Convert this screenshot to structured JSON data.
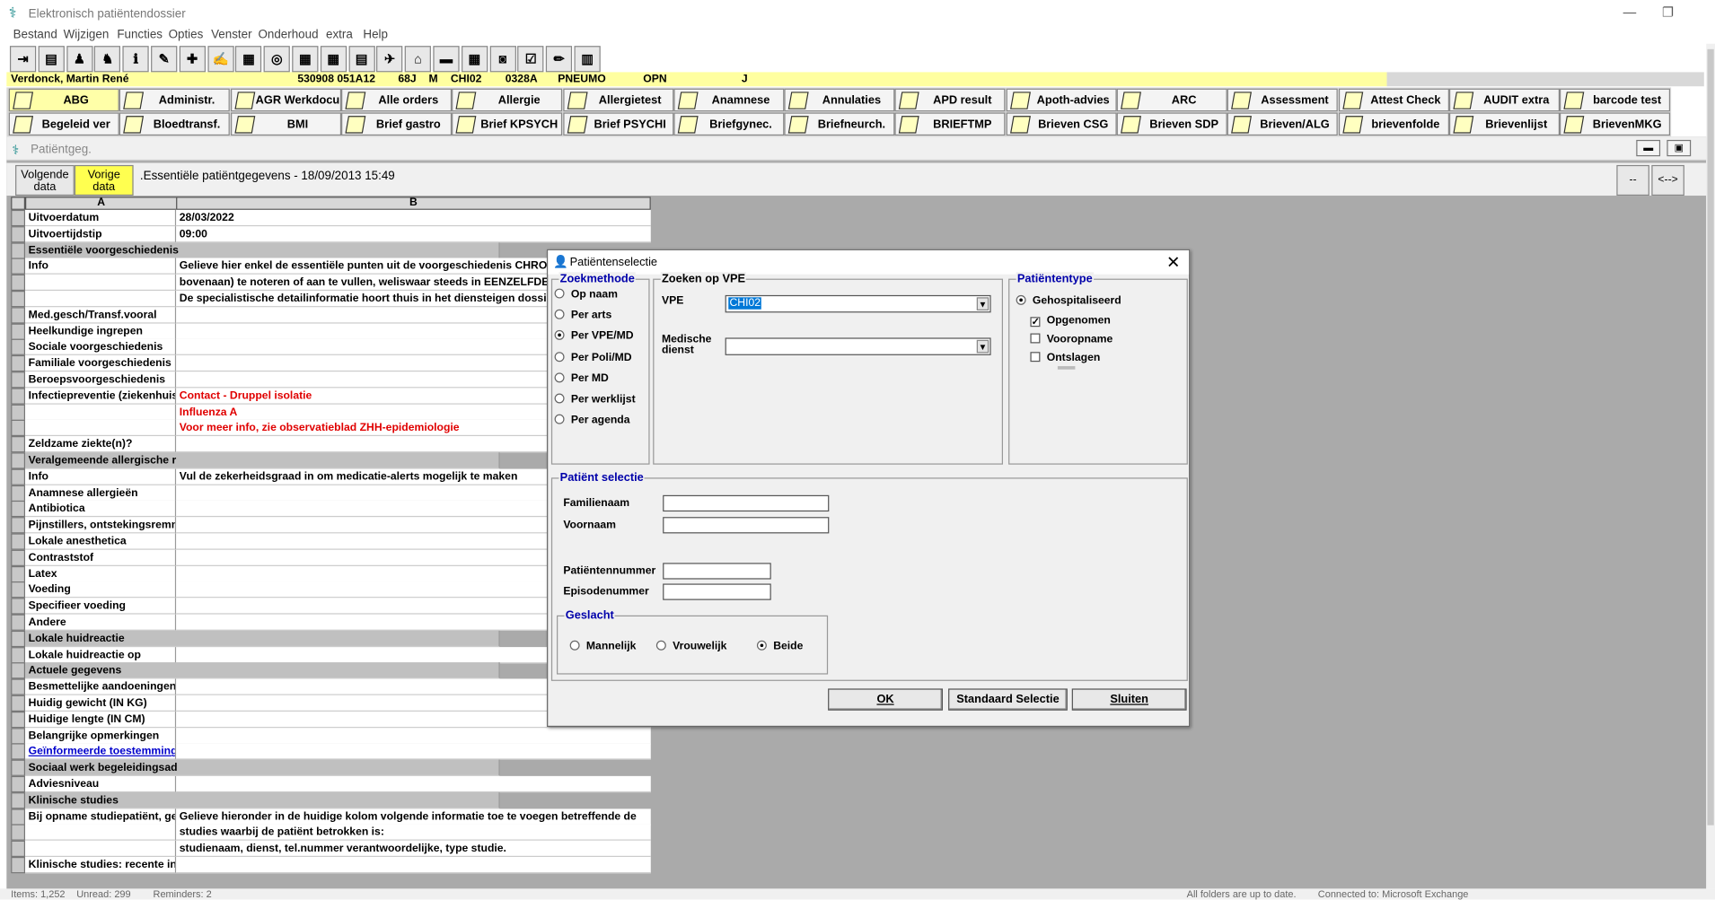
{
  "window": {
    "title": "Elektronisch patiëntendossier",
    "menu": [
      "Bestand",
      "Wijzigen",
      "Functies",
      "Opties",
      "Venster",
      "Onderhoud",
      "extra",
      "Help"
    ]
  },
  "toolbar": {
    "icons": [
      "user-door-icon",
      "printer-icon",
      "person-icon",
      "people-icon",
      "person-info-icon",
      "syringe-icon",
      "pills-icon",
      "edit-doc-icon",
      "calendar-icon",
      "glasses-doc-icon",
      "grid-icon",
      "calendar-grid-icon",
      "report-icon",
      "bird-icon",
      "house-icon",
      "eraser-icon",
      "table-icon",
      "camera-icon",
      "checklist-icon",
      "pen-icon",
      "chart-icon"
    ]
  },
  "patient": {
    "name": "Verdonck,  Martin René",
    "id": "530908 051A12",
    "age": "68J",
    "sex": "M",
    "unit": "CHI02",
    "room": "0328A",
    "dept": "PNEUMO",
    "status": "OPN",
    "flag": "J"
  },
  "folders": {
    "row1": [
      "ABG",
      "Administr.",
      "AGR Werkdocu",
      "Alle orders",
      "Allergie",
      "Allergietest",
      "Anamnese",
      "Annulaties",
      "APD result",
      "Apoth-advies",
      "ARC",
      "Assessment",
      "Attest Check",
      "AUDIT extra",
      "barcode test"
    ],
    "row2": [
      "Begeleid ver",
      "Bloedtransf.",
      "BMI",
      "Brief gastro",
      "Brief KPSYCH",
      "Brief PSYCHI",
      "Briefgynec.",
      "Briefneurch.",
      "BRIEFTMP",
      "Brieven CSG",
      "Brieven SDP",
      "Brieven/ALG",
      "brievenfolde",
      "Brievenlijst",
      "BrievenMKG"
    ]
  },
  "subwindow": {
    "title": "Patiëntgeg.",
    "next_label_1": "Volgende",
    "next_label_2": "data",
    "prev_label_1": "Vorige",
    "prev_label_2": "data",
    "record_title": ".Essentiële patiëntgegevens - 18/09/2013 15:49",
    "right_btn_1": "--",
    "right_btn_2": "<-->",
    "col_a": "A",
    "col_b": "B"
  },
  "rows": [
    {
      "a": "Uitvoerdatum",
      "b": "28/03/2022"
    },
    {
      "a": "Uitvoertijdstip",
      "b": "09:00"
    },
    {
      "a": "Essentiële voorgeschiedenis",
      "section": true
    },
    {
      "a": "Info",
      "b": "Gelieve hier enkel de essentiële punten uit de voorgeschiedenis CHRON"
    },
    {
      "a": "",
      "b": "bovenaan) te noteren of aan te vullen, weliswaar steeds in EENZELFDE"
    },
    {
      "a": "",
      "b": "De specialistische detailinformatie hoort thuis in het diensteigen dossier."
    },
    {
      "a": "Med.gesch/Transf.vooral",
      "b": ""
    },
    {
      "a": "Heelkundige ingrepen",
      "b": ""
    },
    {
      "a": "Sociale voorgeschiedenis",
      "b": ""
    },
    {
      "a": "Familiale voorgeschiedenis",
      "b": ""
    },
    {
      "a": "Beroepsvoorgeschiedenis",
      "b": ""
    },
    {
      "a": "Infectiepreventie (ziekenhuis",
      "b": "Contact - Druppel isolatie",
      "red": true
    },
    {
      "a": "",
      "b": "Influenza A",
      "red": true
    },
    {
      "a": "",
      "b": "Voor meer info, zie observatieblad ZHH-epidemiologie",
      "red": true
    },
    {
      "a": "Zeldzame ziekte(n)?",
      "b": ""
    },
    {
      "a": "Veralgemeende allergische r",
      "section": true
    },
    {
      "a": "Info",
      "b": "Vul de zekerheidsgraad in om medicatie-alerts mogelijk te maken"
    },
    {
      "a": "Anamnese allergieën",
      "b": ""
    },
    {
      "a": "Antibiotica",
      "b": ""
    },
    {
      "a": "Pijnstillers, ontstekingsremme",
      "b": ""
    },
    {
      "a": "Lokale anesthetica",
      "b": ""
    },
    {
      "a": "Contraststof",
      "b": ""
    },
    {
      "a": "Latex",
      "b": ""
    },
    {
      "a": "Voeding",
      "b": ""
    },
    {
      "a": "    Specifieer voeding",
      "b": ""
    },
    {
      "a": "Andere",
      "b": ""
    },
    {
      "a": "Lokale huidreactie",
      "section": true
    },
    {
      "a": "Lokale huidreactie op",
      "b": ""
    },
    {
      "a": "Actuele gegevens",
      "section": true
    },
    {
      "a": "Besmettelijke aandoeningen",
      "b": ""
    },
    {
      "a": "Huidig gewicht (IN KG)",
      "b": ""
    },
    {
      "a": "Huidige lengte (IN CM)",
      "b": ""
    },
    {
      "a": "Belangrijke opmerkingen",
      "b": ""
    },
    {
      "a": "Geïnformeerde toestemming",
      "b": "",
      "link": true
    },
    {
      "a": "Sociaal werk begeleidingsad",
      "section": true
    },
    {
      "a": "Adviesniveau",
      "b": ""
    },
    {
      "a": "Klinische studies",
      "section": true
    },
    {
      "a": "Bij opname studiepatiënt, gel",
      "b": "Gelieve hieronder in de huidige kolom volgende informatie toe te voegen betreffende de"
    },
    {
      "a": "",
      "b": "studies waarbij de patiënt betrokken is:"
    },
    {
      "a": "",
      "b": "studienaam, dienst, tel.nummer verantwoordelijke, type studie."
    },
    {
      "a": "Klinische studies: recente inf",
      "b": ""
    }
  ],
  "dialog": {
    "title": "Patiëntenselectie",
    "zoekmethode_label": "Zoekmethode",
    "methods": [
      "Op naam",
      "Per arts",
      "Per VPE/MD",
      "Per Poli/MD",
      "Per MD",
      "Per werklijst",
      "Per agenda"
    ],
    "selected_method": "Per VPE/MD",
    "zoeken_label": "Zoeken op VPE",
    "vpe_label": "VPE",
    "vpe_value": "CHI02",
    "medische_label_1": "Medische",
    "medische_label_2": "dienst",
    "medische_value": "",
    "patienttype_label": "Patiëntentype",
    "patienttype_radio": "Gehospitaliseerd",
    "checks": [
      {
        "label": "Opgenomen",
        "checked": true
      },
      {
        "label": "Vooropname",
        "checked": false
      },
      {
        "label": "Ontslagen",
        "checked": false
      }
    ],
    "selectie_label": "Patiënt selectie",
    "familienaam_label": "Familienaam",
    "voornaam_label": "Voornaam",
    "patientnummer_label": "Patiëntennummer",
    "episodenummer_label": "Episodenummer",
    "geslacht_label": "Geslacht",
    "geslacht": [
      "Mannelijk",
      "Vrouwelijk",
      "Beide"
    ],
    "geslacht_selected": "Beide",
    "ok": "OK",
    "standaard": "Standaard Selectie",
    "sluiten": "Sluiten"
  },
  "status": {
    "items": "Items: 1,252",
    "unread": "Unread: 299",
    "reminders": "Reminders: 2",
    "folders": "All folders are up to date.",
    "connected": "Connected to: Microsoft Exchange"
  }
}
